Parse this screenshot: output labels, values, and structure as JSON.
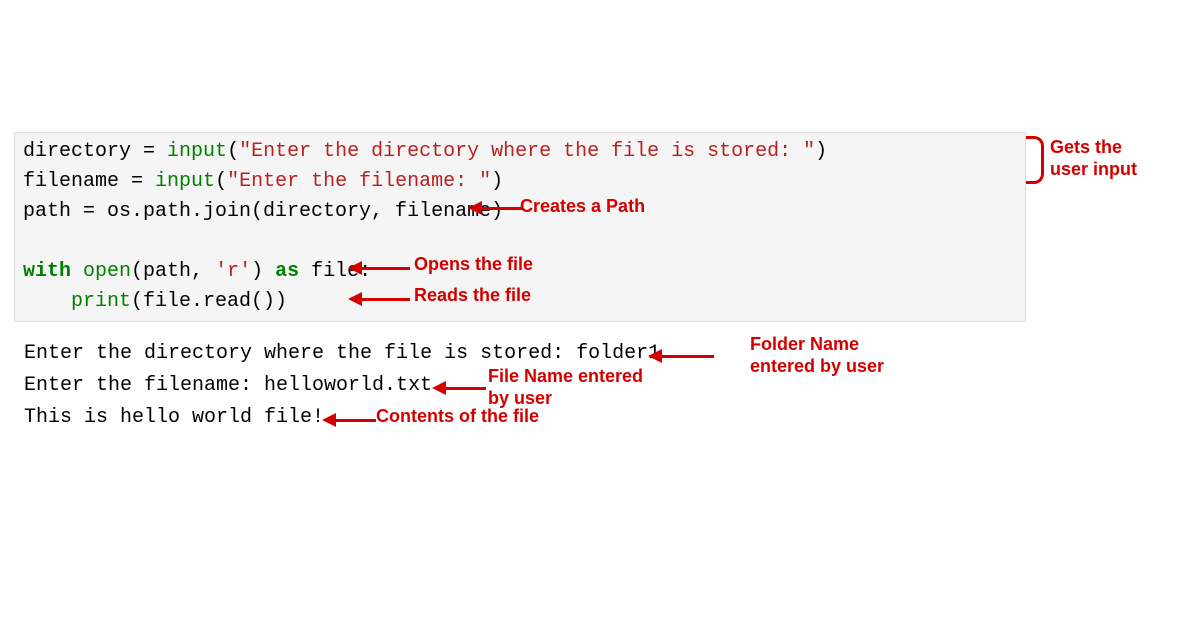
{
  "code": {
    "line1": {
      "var": "directory ",
      "op": "= ",
      "fn": "input",
      "paren1": "(",
      "str": "\"Enter the directory where the file is stored: \"",
      "paren2": ")"
    },
    "line2": {
      "var": "filename ",
      "op": "= ",
      "fn": "input",
      "paren1": "(",
      "str": "\"Enter the filename: \"",
      "paren2": ")"
    },
    "line3": {
      "full": "path = os.path.join(directory, filename)"
    },
    "line4": {
      "blank": " "
    },
    "line5": {
      "kw1": "with",
      "sp1": " ",
      "fn": "open",
      "args": "(path, ",
      "str": "'r'",
      "args2": ") ",
      "kw2": "as",
      "rest": " file:"
    },
    "line6": {
      "indent": "    ",
      "fn": "print",
      "rest": "(file.read())"
    }
  },
  "output": {
    "line1": "Enter the directory where the file is stored: folder1",
    "line2": "Enter the filename: helloworld.txt",
    "line3": "This is hello world file!"
  },
  "annotations": {
    "gets_input": "Gets the\nuser input",
    "creates_path": "Creates a Path",
    "opens_file": "Opens the file",
    "reads_file": "Reads the file",
    "folder_name": "Folder Name\nentered by user",
    "file_name": "File Name entered\nby user",
    "contents": "Contents of the file"
  }
}
